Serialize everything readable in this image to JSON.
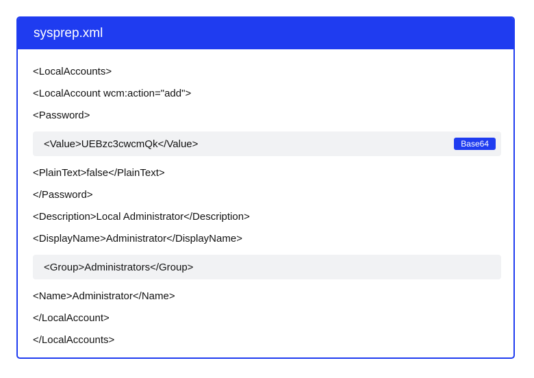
{
  "file": {
    "title": "sysprep.xml"
  },
  "lines": [
    "<LocalAccounts>",
    "<LocalAccount wcm:action=\"add\">",
    "<Password>",
    "<Value>UEBzc3cwcmQk</Value>",
    "<PlainText>false</PlainText>",
    "</Password>",
    "<Description>Local Administrator</Description>",
    "<DisplayName>Administrator</DisplayName>",
    "<Group>Administrators</Group>",
    "<Name>Administrator</Name>",
    "</LocalAccount>",
    "</LocalAccounts>"
  ],
  "badges": {
    "value_encoding": "Base64"
  },
  "colors": {
    "accent": "#1f3cf0",
    "highlight_bg": "#f1f2f4"
  }
}
